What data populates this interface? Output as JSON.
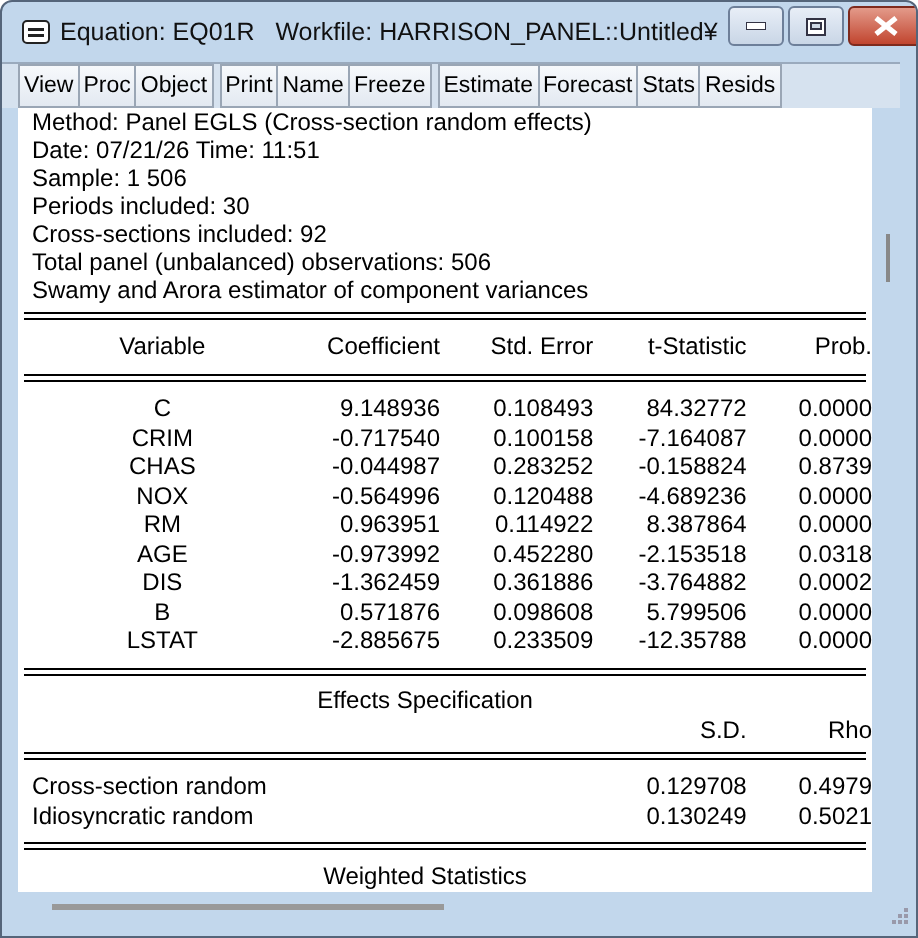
{
  "window": {
    "title": "Equation: EQ01R   Workfile: HARRISON_PANEL::Untitled¥"
  },
  "toolbar": {
    "groups": [
      [
        "View",
        "Proc",
        "Object"
      ],
      [
        "Print",
        "Name",
        "Freeze"
      ],
      [
        "Estimate",
        "Forecast",
        "Stats",
        "Resids"
      ]
    ]
  },
  "output": {
    "header_lines": [
      "Method: Panel EGLS (Cross-section random effects)",
      "Date: 07/21/26   Time: 11:51",
      "Sample: 1 506",
      "Periods included: 30",
      "Cross-sections included: 92",
      "Total panel (unbalanced) observations: 506",
      "Swamy and Arora estimator of component variances"
    ],
    "coefficients": {
      "columns": [
        "Variable",
        "Coefficient",
        "Std. Error",
        "t-Statistic",
        "Prob."
      ],
      "rows": [
        [
          "C",
          "9.148936",
          "0.108493",
          "84.32772",
          "0.0000"
        ],
        [
          "CRIM",
          "-0.717540",
          "0.100158",
          "-7.164087",
          "0.0000"
        ],
        [
          "CHAS",
          "-0.044987",
          "0.283252",
          "-0.158824",
          "0.8739"
        ],
        [
          "NOX",
          "-0.564996",
          "0.120488",
          "-4.689236",
          "0.0000"
        ],
        [
          "RM",
          "0.963951",
          "0.114922",
          "8.387864",
          "0.0000"
        ],
        [
          "AGE",
          "-0.973992",
          "0.452280",
          "-2.153518",
          "0.0318"
        ],
        [
          "DIS",
          "-1.362459",
          "0.361886",
          "-3.764882",
          "0.0002"
        ],
        [
          "B",
          "0.571876",
          "0.098608",
          "5.799506",
          "0.0000"
        ],
        [
          "LSTAT",
          "-2.885675",
          "0.233509",
          "-12.35788",
          "0.0000"
        ]
      ]
    },
    "effects": {
      "title": "Effects Specification",
      "columns": [
        "",
        "S.D.",
        "Rho"
      ],
      "rows": [
        [
          "Cross-section random",
          "0.129708",
          "0.4979"
        ],
        [
          "Idiosyncratic random",
          "0.130249",
          "0.5021"
        ]
      ]
    },
    "next_section_title": "Weighted Statistics"
  }
}
